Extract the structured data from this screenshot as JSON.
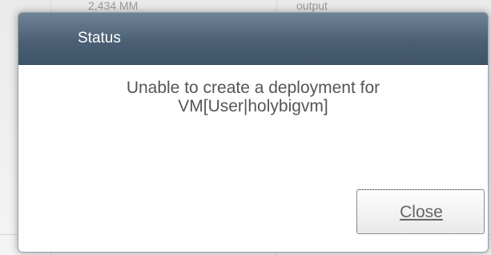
{
  "background": {
    "partial_text_left": "2,434 MM",
    "partial_text_right": "output"
  },
  "dialog": {
    "title": "Status",
    "message_lines": [
      "Unable to create a deployment for",
      "VM[User|holybigvm]"
    ],
    "close_label": "Close"
  },
  "colors": {
    "titlebar": "#4b6075",
    "title_text": "#ffffff",
    "message_text": "#555555",
    "button_text": "#666666"
  }
}
